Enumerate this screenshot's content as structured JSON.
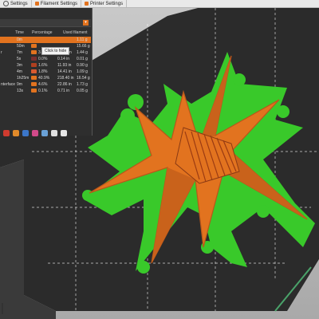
{
  "tabs": [
    {
      "label": "Settings",
      "icon": "gear-icon"
    },
    {
      "label": "Filament Settings",
      "icon": "filament-icon"
    },
    {
      "label": "Printer Settings",
      "icon": "printer-icon"
    }
  ],
  "panel": {
    "columns": [
      "Time",
      "Percentage",
      "Used filament"
    ],
    "tooltip": "Click to hide",
    "rows": [
      {
        "name": "",
        "time": "0m",
        "pct": "",
        "len": "",
        "weight": "1.11 g",
        "color": "#e2731f",
        "selected": true
      },
      {
        "name": "",
        "time": "50m",
        "pct": "",
        "len": "",
        "weight": "15.66 g",
        "color": "#e2731f",
        "selected": false
      },
      {
        "name": "r",
        "time": "7m",
        "pct": "3.4%",
        "len": "19.04 in",
        "weight": "1.44 g",
        "color": "#e2731f",
        "selected": false
      },
      {
        "name": "",
        "time": "5s",
        "pct": "0.0%",
        "len": "0.14 in",
        "weight": "0.01 g",
        "color": "#7a2f2f",
        "selected": false
      },
      {
        "name": "",
        "time": "3m",
        "pct": "1.6%",
        "len": "11.93 in",
        "weight": "0.90 g",
        "color": "#b04020",
        "selected": false
      },
      {
        "name": "",
        "time": "4m",
        "pct": "1.8%",
        "len": "14.41 in",
        "weight": "1.09 g",
        "color": "#d85a30",
        "selected": false
      },
      {
        "name": "",
        "time": "1h25m",
        "pct": "40.9%",
        "len": "218.40 in",
        "weight": "16.54 g",
        "color": "#e2731f",
        "selected": false
      },
      {
        "name": "nterface",
        "time": "9m",
        "pct": "4.6%",
        "len": "22.86 in",
        "weight": "1.73 g",
        "color": "#e2731f",
        "selected": false
      },
      {
        "name": "",
        "time": "13s",
        "pct": "0.1%",
        "len": "0.71 in",
        "weight": "0.05 g",
        "color": "#e2731f",
        "selected": false
      }
    ],
    "tools": [
      {
        "icon": "layers-icon",
        "color": "#cf3b2f"
      },
      {
        "icon": "palette-icon",
        "color": "#e08a2a"
      },
      {
        "icon": "color-wheel-icon",
        "color": "#3b76c8"
      },
      {
        "icon": "object-icon",
        "color": "#d14a8a"
      },
      {
        "icon": "cube-icon",
        "color": "#6aa1d6"
      },
      {
        "icon": "cube-outline-icon",
        "color": "#e0e0e0"
      },
      {
        "icon": "download-icon",
        "color": "#e6e6e6"
      }
    ]
  },
  "colors": {
    "model_orange": "#e2731f",
    "model_dark": "#b9571a",
    "support_green": "#39c92a",
    "plate": "#2b2b2b",
    "accent": "#e2731f"
  }
}
